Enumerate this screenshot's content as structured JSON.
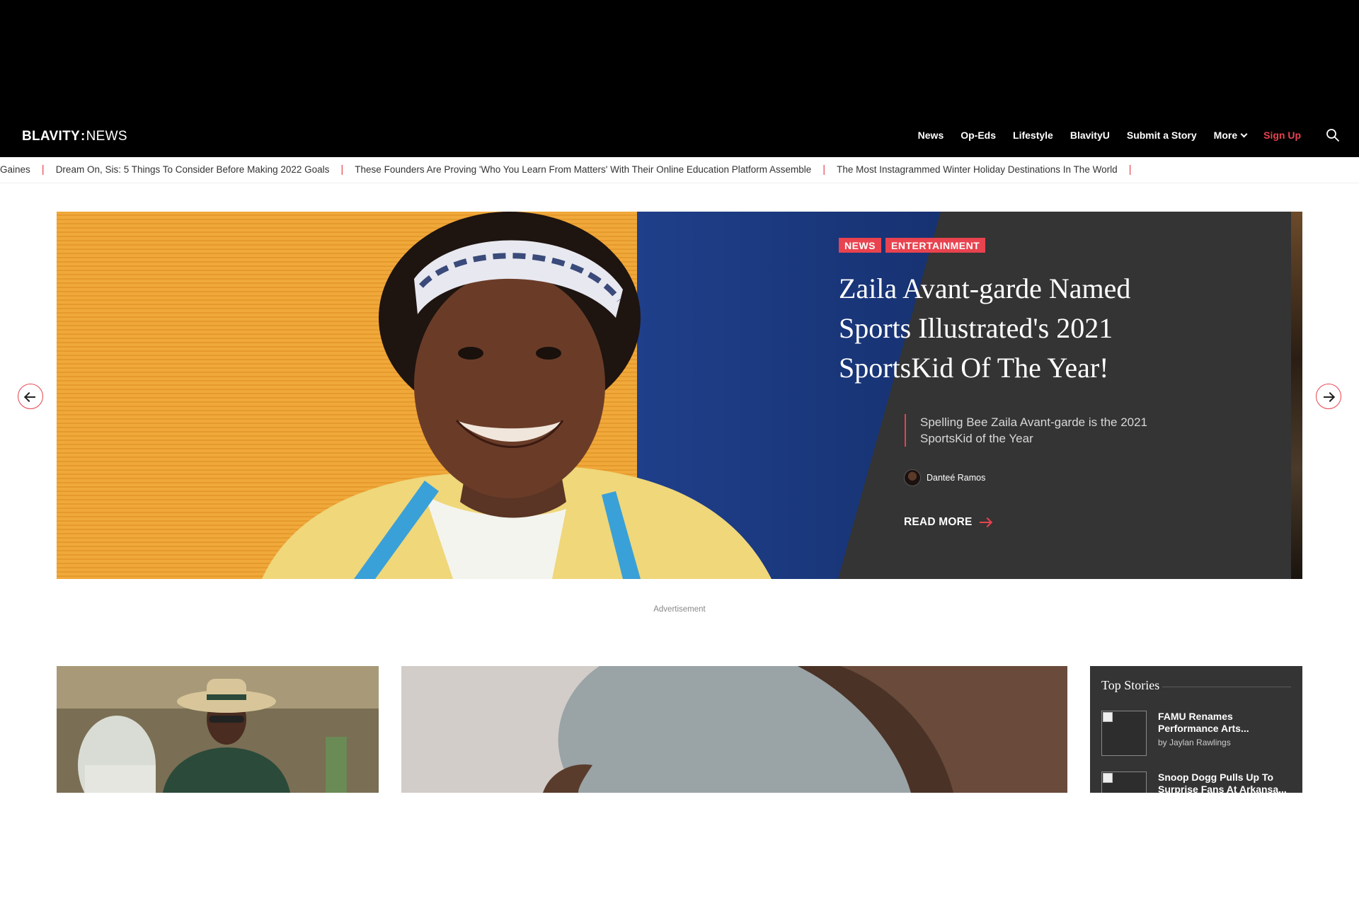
{
  "logo": {
    "brand": "BLAVITY",
    "separator": ":",
    "section": "NEWS"
  },
  "nav": {
    "items": [
      {
        "label": "News"
      },
      {
        "label": "Op-Eds"
      },
      {
        "label": "Lifestyle"
      },
      {
        "label": "BlavityU"
      },
      {
        "label": "Submit a Story"
      },
      {
        "label": "More"
      },
      {
        "label": "Sign Up"
      }
    ],
    "search_icon": "search-icon"
  },
  "ticker": {
    "items": [
      "Gaines",
      "Dream On, Sis: 5 Things To Consider Before Making 2022 Goals",
      "These Founders Are Proving 'Who You Learn From Matters' With Their Online Education Platform Assemble",
      "The Most Instagrammed Winter Holiday Destinations In The World"
    ],
    "separator": "|"
  },
  "hero": {
    "tags": [
      "NEWS",
      "ENTERTAINMENT"
    ],
    "title": "Zaila Avant-garde Named Sports Illustrated's 2021 SportsKid Of The Year!",
    "subtitle": "Spelling Bee Zaila Avant-garde is the 2021 SportsKid of the Year",
    "author": "Danteé Ramos",
    "read_more": "READ MORE"
  },
  "advertisement_label": "Advertisement",
  "top_stories": {
    "title": "Top Stories",
    "items": [
      {
        "headline": "FAMU Renames Performance Arts...",
        "byline": "by Jaylan Rawlings"
      },
      {
        "headline": "Snoop Dogg Pulls Up To Surprise Fans At Arkansa...",
        "byline": ""
      }
    ]
  },
  "colors": {
    "accent": "#e8434f",
    "header_bg": "#000000",
    "panel_bg": "#343434"
  }
}
